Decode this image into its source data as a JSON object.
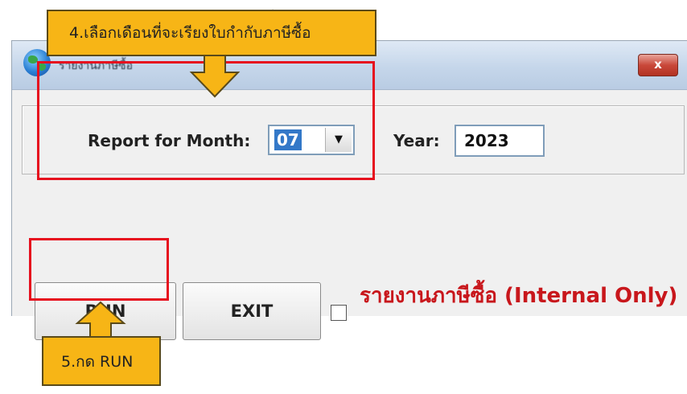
{
  "window": {
    "title": "รายงานภาษีซื้อ",
    "close_glyph": "x"
  },
  "form": {
    "month_label": "Report for Month:",
    "month_value": "07",
    "year_label": "Year:",
    "year_value": "2023"
  },
  "actions": {
    "run_label": "RUN",
    "exit_label": "EXIT",
    "internal_only_label": "รายงานภาษีซื้อ (Internal Only)",
    "internal_only_checked": false
  },
  "annotations": {
    "step4": "4.เลือกเดือนที่จะเรียงใบกำกับภาษีซื้อ",
    "step5": "5.กด RUN"
  },
  "icons": {
    "app": "globe-icon",
    "close": "close-icon",
    "dropdown": "chevron-down-icon"
  },
  "colors": {
    "callout": "#f7b516",
    "highlight": "#e60f1e",
    "internal_label": "#c8171c",
    "selection": "#3378c8"
  }
}
